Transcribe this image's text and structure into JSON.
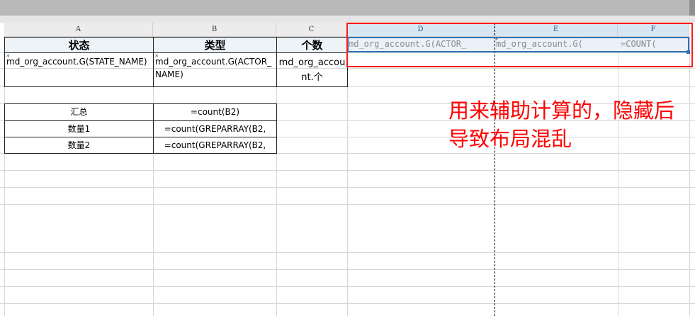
{
  "columns": [
    "A",
    "B",
    "C",
    "D",
    "E",
    "F"
  ],
  "headers": {
    "A": "状态",
    "B": "类型",
    "C": "个数"
  },
  "row2": {
    "A": "md_org_account.G(STATE_NAME)",
    "B": "md_org_account.G(ACTOR_NAME)",
    "C": "md_org_account.个"
  },
  "summary": [
    {
      "label": "汇总",
      "formula": "=count(B2)"
    },
    {
      "label": "数量1",
      "formula": "=count(GREPARRAY(B2,"
    },
    {
      "label": "数量2",
      "formula": "=count(GREPARRAY(B2,"
    }
  ],
  "helper": {
    "D": "md_org_account.G(ACTOR_",
    "E": "md_org_account.G(",
    "F": "=COUNT("
  },
  "cell_marker": "*",
  "annotation": "用来辅助计算的，隐藏后导致布局混乱",
  "colors": {
    "annotation": "#ff0000",
    "selection": "#2f75b5",
    "grid": "#d6d6d6"
  }
}
